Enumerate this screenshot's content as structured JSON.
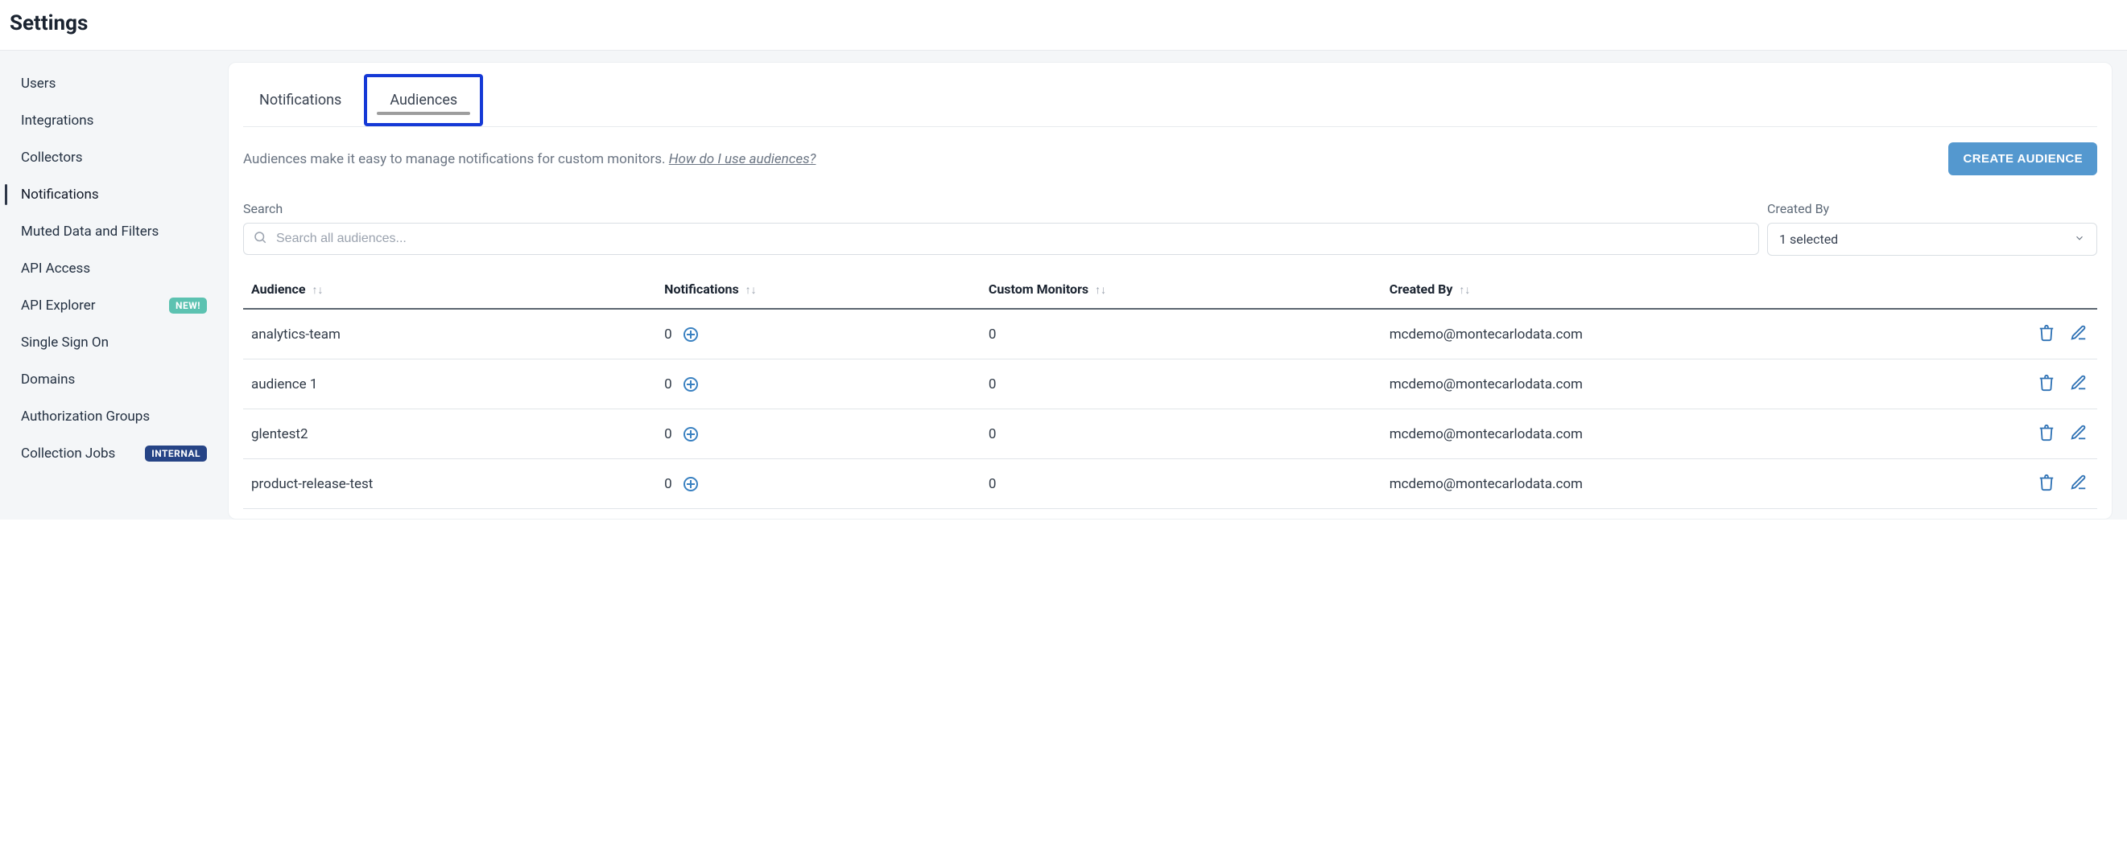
{
  "page": {
    "title": "Settings"
  },
  "sidebar": {
    "items": [
      {
        "label": "Users",
        "badge": null
      },
      {
        "label": "Integrations",
        "badge": null
      },
      {
        "label": "Collectors",
        "badge": null
      },
      {
        "label": "Notifications",
        "badge": null,
        "active": true
      },
      {
        "label": "Muted Data and Filters",
        "badge": null
      },
      {
        "label": "API Access",
        "badge": null
      },
      {
        "label": "API Explorer",
        "badge": "NEW!"
      },
      {
        "label": "Single Sign On",
        "badge": null
      },
      {
        "label": "Domains",
        "badge": null
      },
      {
        "label": "Authorization Groups",
        "badge": null
      },
      {
        "label": "Collection Jobs",
        "badge": "INTERNAL"
      }
    ]
  },
  "tabs": {
    "notifications": "Notifications",
    "audiences": "Audiences"
  },
  "info": {
    "text": "Audiences make it easy to manage notifications for custom monitors. ",
    "link": "How do I use audiences?"
  },
  "buttons": {
    "create": "CREATE AUDIENCE"
  },
  "filters": {
    "searchLabel": "Search",
    "searchPlaceholder": "Search all audiences...",
    "createdByLabel": "Created By",
    "createdByValue": "1 selected"
  },
  "table": {
    "headers": {
      "audience": "Audience",
      "notifications": "Notifications",
      "monitors": "Custom Monitors",
      "createdBy": "Created By"
    },
    "rows": [
      {
        "audience": "analytics-team",
        "notifications": "0",
        "monitors": "0",
        "createdBy": "mcdemo@montecarlodata.com"
      },
      {
        "audience": "audience 1",
        "notifications": "0",
        "monitors": "0",
        "createdBy": "mcdemo@montecarlodata.com"
      },
      {
        "audience": "glentest2",
        "notifications": "0",
        "monitors": "0",
        "createdBy": "mcdemo@montecarlodata.com"
      },
      {
        "audience": "product-release-test",
        "notifications": "0",
        "monitors": "0",
        "createdBy": "mcdemo@montecarlodata.com"
      }
    ]
  }
}
